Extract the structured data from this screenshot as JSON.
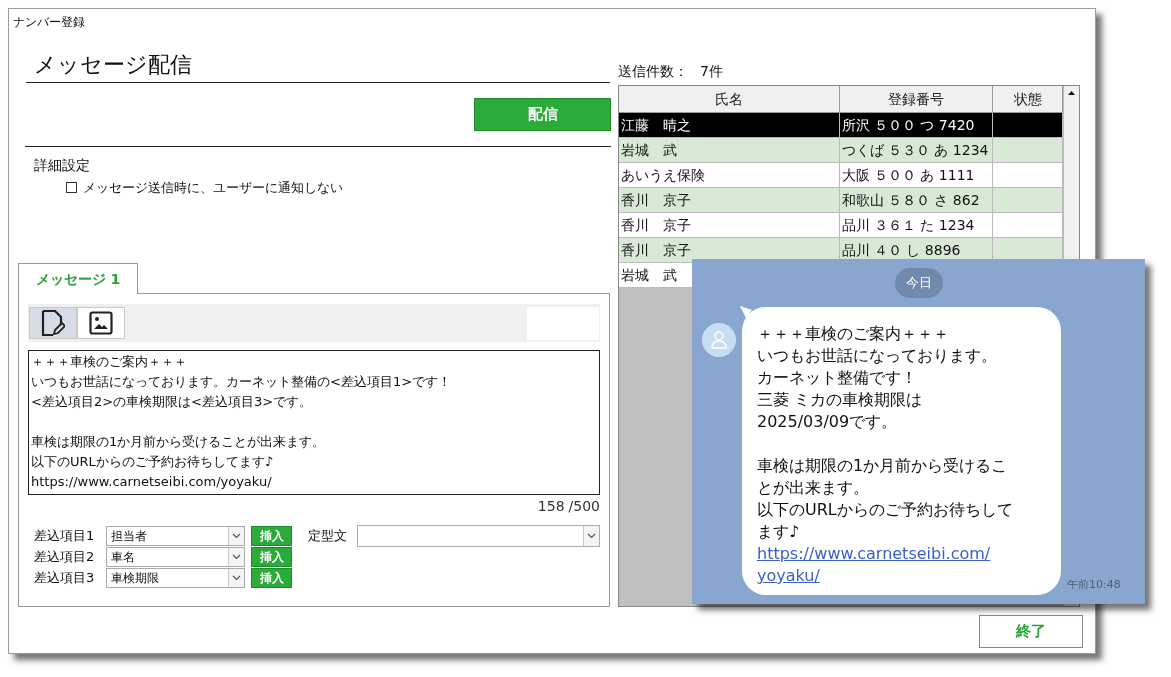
{
  "window": {
    "title": "ナンバー登録"
  },
  "heading": "メッセージ配信",
  "send_button": "配信",
  "details": {
    "title": "詳細設定",
    "option": {
      "label": "メッセージ送信時に、ユーザーに通知しない",
      "checked": false
    }
  },
  "tabs": [
    {
      "label": "メッセージ 1",
      "selected": true
    }
  ],
  "editor": {
    "tools": [
      {
        "kind": "text",
        "selected": true
      },
      {
        "kind": "image",
        "selected": false
      }
    ],
    "paragraphs": [
      [
        "＋＋＋車検のご案内＋＋＋",
        "いつもお世話になっております。カーネット整備の<差込項目1>です！",
        "<差込項目2>の車検期限は<差込項目3>です。"
      ],
      [
        "車検は期限の1か月前から受けることが出来ます。",
        "以下のURLからのご予約お待ちしてます♪",
        "https://www.carnetseibi.com/yoyaku/"
      ]
    ],
    "char_count": "158",
    "char_limit": "/500"
  },
  "inserts": [
    {
      "label": "差込項目1",
      "value": "担当者",
      "button": "挿入"
    },
    {
      "label": "差込項目2",
      "value": "車名",
      "button": "挿入"
    },
    {
      "label": "差込項目3",
      "value": "車検期限",
      "button": "挿入"
    }
  ],
  "template": {
    "label": "定型文"
  },
  "count": {
    "label": "送信件数：",
    "value": "7件"
  },
  "table": {
    "columns": [
      "氏名",
      "登録番号",
      "状態"
    ],
    "rows": [
      {
        "cells": [
          "江藤　晴之",
          "所沢 ５００ つ 7420"
        ],
        "selected": true
      },
      {
        "cells": [
          "岩城　武",
          "つくば ５３０ あ 1234"
        ],
        "selected": false
      },
      {
        "cells": [
          "あいうえ保険",
          "大阪 ５００ あ 1111"
        ],
        "selected": false
      },
      {
        "cells": [
          "香川　京子",
          "和歌山 ５８０ さ 862"
        ],
        "selected": false
      },
      {
        "cells": [
          "香川　京子",
          "品川 ３６１ た 1234"
        ],
        "selected": false
      },
      {
        "cells": [
          "香川　京子",
          "品川 ４０ し 8896"
        ],
        "selected": false
      },
      {
        "cells": [
          "岩城　武"
        ],
        "selected": false
      }
    ]
  },
  "chat": {
    "date": "今日",
    "paragraphs": [
      [
        "＋＋＋車検のご案内＋＋＋",
        "いつもお世話になっております。",
        "カーネット整備です！",
        "三菱 ミカの車検期限は",
        "2025/03/09です。"
      ],
      [
        "車検は期限の1か月前から受けるこ",
        "とが出来ます。",
        "以下のURLからのご予約お待ちして",
        "ます♪"
      ]
    ],
    "link": [
      "https://www.carnetseibi.com/",
      "yoyaku/"
    ],
    "time": "午前10:48"
  },
  "close_button": "終了"
}
